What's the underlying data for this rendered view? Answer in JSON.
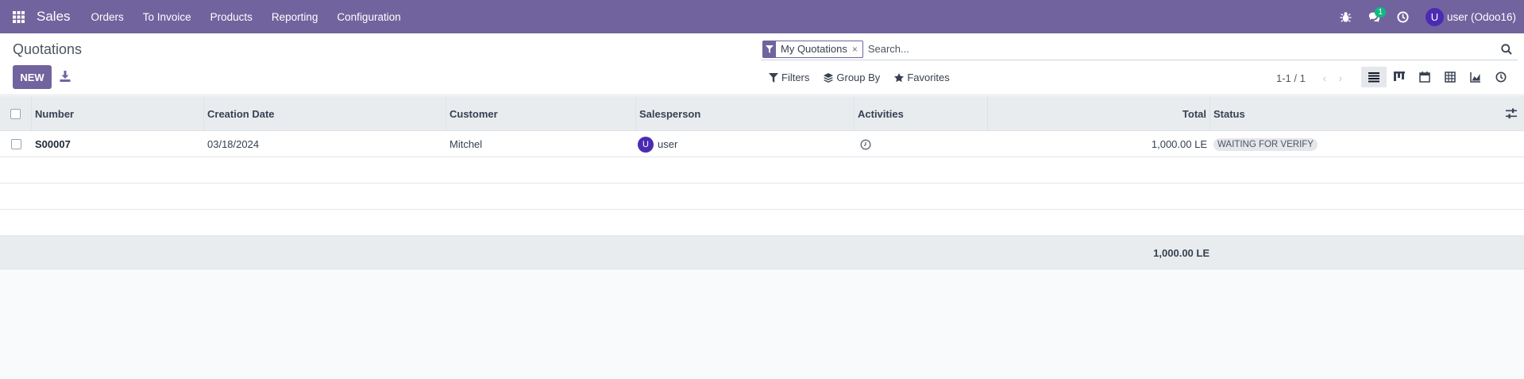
{
  "navbar": {
    "app_name": "Sales",
    "menu": [
      "Orders",
      "To Invoice",
      "Products",
      "Reporting",
      "Configuration"
    ],
    "messages_badge": "1",
    "user_initial": "U",
    "user_name": "user (Odoo16)",
    "bg_color": "#71639e"
  },
  "control": {
    "title": "Quotations",
    "new_label": "NEW",
    "facet_label": "My Quotations",
    "facet_remove": "×",
    "search_placeholder": "Search...",
    "filters_label": "Filters",
    "groupby_label": "Group By",
    "favorites_label": "Favorites",
    "pager": "1-1 / 1"
  },
  "table": {
    "columns": [
      "Number",
      "Creation Date",
      "Customer",
      "Salesperson",
      "Activities",
      "Total",
      "Status"
    ],
    "rows": [
      {
        "number": "S00007",
        "creation_date": "03/18/2024",
        "customer": "Mitchel",
        "salesperson_initial": "U",
        "salesperson": "user",
        "total": "1,000.00 LE",
        "status": "WAITING FOR VERIFY"
      }
    ],
    "footer_total": "1,000.00 LE"
  }
}
